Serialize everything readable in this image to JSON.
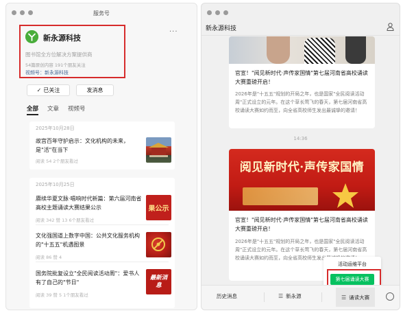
{
  "left_window": {
    "title": "服务号",
    "account": {
      "name": "新永源科技",
      "description": "图书馆全方位解决方案提供商",
      "stats": "54篇原创内容  191个朋友关注",
      "video_channel": "视频号：新永源科技"
    },
    "more_label": "···",
    "followed_label": "已关注",
    "message_label": "发消息",
    "tabs": [
      {
        "label": "全部",
        "active": true
      },
      {
        "label": "文章",
        "active": false
      },
      {
        "label": "视频号",
        "active": false
      }
    ],
    "groups": [
      {
        "date": "2025年10月28日",
        "articles": [
          {
            "title": "故宫百年守护启示：文化机构的未来，是\"活\"在当下",
            "meta": "阅读 54  2个朋友看过",
            "thumb": "palace"
          }
        ]
      },
      {
        "date": "2025年10月25日",
        "articles": [
          {
            "title": "赓续华夏文脉·唱响时代新篇：第六届河南省高校主题诵读大赛结果公示",
            "meta": "阅读 342  赞 13  6个朋友看过",
            "thumb": "results",
            "thumb_text": "果公示"
          },
          {
            "title": "文化强国道上数字中国：公共文化服务机构的\"十五五\"机遇图景",
            "meta": "阅读 86  赞 4",
            "thumb": "party"
          },
          {
            "title": "国务院批复设立\"全民阅读活动周\"：爱书人有了自己的\"节日\"",
            "meta": "阅读 39  赞 5  1个朋友看过",
            "thumb": "news",
            "thumb_text": "最新消息"
          }
        ]
      }
    ]
  },
  "right_window": {
    "title": "新永源科技",
    "messages": [
      {
        "title": "官宣！\"阅见新时代·声传家国情\"第七届河南省高校诵读大赛重磅开启！",
        "body": "2026年是\"十五五\"规划的开局之年，也是国家\"全民阅读活动周\"正式设立的元年。在这个草长莺飞的春天，第七届河南省高校诵读大赛如约而至，向全省高校师生发出最诚挚的邀请！"
      },
      {
        "banner_text": "阅见新时代·声传家国情",
        "title": "官宣！\"阅见新时代·声传家国情\"第七届河南省高校诵读大赛重磅开启！",
        "body": "2026年是\"十五五\"规划的开局之年，也是国家\"全民阅读活动周\"正式设立的元年。在这个草长莺飞的春天，第七届河南省高校诵读大赛如约而至，向全省高校师生发出最诚挚的邀请！"
      }
    ],
    "time_divider": "14:36",
    "bottom_menu": [
      "历史消息",
      "新永源",
      "诵读大赛"
    ],
    "popup": {
      "item1": "活动运维平台",
      "item2": "第七届诵读大赛"
    }
  },
  "colors": {
    "highlight": "#d62b2b",
    "wechat_green": "#07c160",
    "logo_green": "#49ad3b",
    "link_blue": "#486a96"
  }
}
